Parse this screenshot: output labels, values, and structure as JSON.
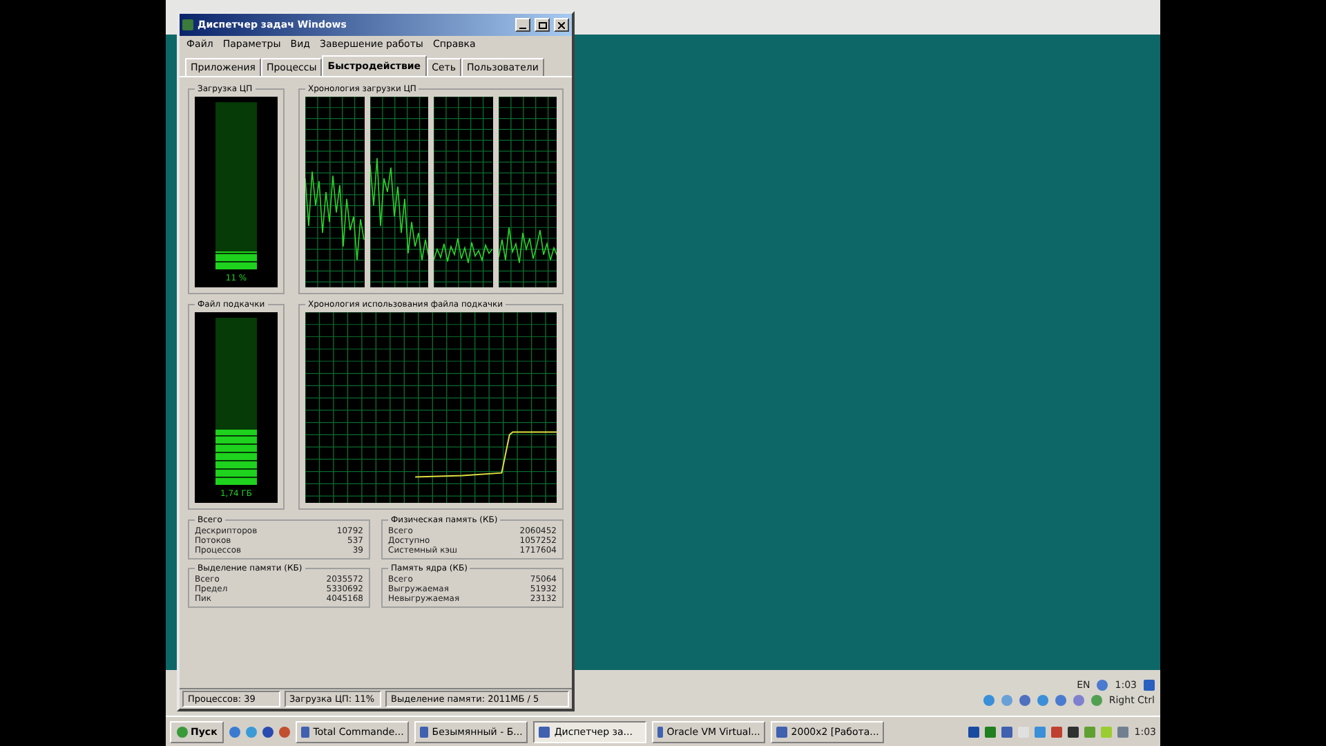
{
  "window": {
    "title": "Диспетчер задач Windows",
    "menu": [
      "Файл",
      "Параметры",
      "Вид",
      "Завершение работы",
      "Справка"
    ],
    "tabs": [
      {
        "label": "Приложения",
        "selected": false
      },
      {
        "label": "Процессы",
        "selected": false
      },
      {
        "label": "Быстродействие",
        "selected": true
      },
      {
        "label": "Сеть",
        "selected": false
      },
      {
        "label": "Пользователи",
        "selected": false
      }
    ],
    "cpu_usage": {
      "label": "Загрузка ЦП",
      "reading": "11 %",
      "level": 0.11
    },
    "cpu_history": {
      "label": "Хронология загрузки ЦП"
    },
    "pagefile": {
      "label": "Файл подкачки",
      "reading": "1,74 ГБ",
      "level": 0.33
    },
    "pagefile_history": {
      "label": "Хронология использования файла подкачки"
    },
    "stats": [
      {
        "title": "Всего",
        "rows": [
          {
            "label": "Дескрипторов",
            "value": "10792"
          },
          {
            "label": "Потоков",
            "value": "537"
          },
          {
            "label": "Процессов",
            "value": "39"
          }
        ]
      },
      {
        "title": "Физическая память (КБ)",
        "rows": [
          {
            "label": "Всего",
            "value": "2060452"
          },
          {
            "label": "Доступно",
            "value": "1057252"
          },
          {
            "label": "Системный кэш",
            "value": "1717604"
          }
        ]
      },
      {
        "title": "Выделение памяти (КБ)",
        "rows": [
          {
            "label": "Всего",
            "value": "2035572"
          },
          {
            "label": "Предел",
            "value": "5330692"
          },
          {
            "label": "Пик",
            "value": "4045168"
          }
        ]
      },
      {
        "title": "Память ядра (КБ)",
        "rows": [
          {
            "label": "Всего",
            "value": "75064"
          },
          {
            "label": "Выгружаемая",
            "value": "51932"
          },
          {
            "label": "Невыгружаемая",
            "value": "23132"
          }
        ]
      }
    ],
    "status_bar": [
      "Процессов: 39",
      "Загрузка ЦП: 11%",
      "Выделение памяти: 2011МБ / 5"
    ]
  },
  "vm_tray": {
    "language": "EN",
    "clock": "1:03",
    "host_key": "Right Ctrl"
  },
  "taskbar": {
    "start": "Пуск",
    "buttons": [
      {
        "label": "Total Commande...",
        "selected": false
      },
      {
        "label": "Безымянный - Б...",
        "selected": false
      },
      {
        "label": "Диспетчер за...",
        "selected": true
      },
      {
        "label": "Oracle VM Virtual...",
        "selected": false
      },
      {
        "label": "2000x2 [Работа...",
        "selected": false
      }
    ],
    "clock": "1:03"
  }
}
